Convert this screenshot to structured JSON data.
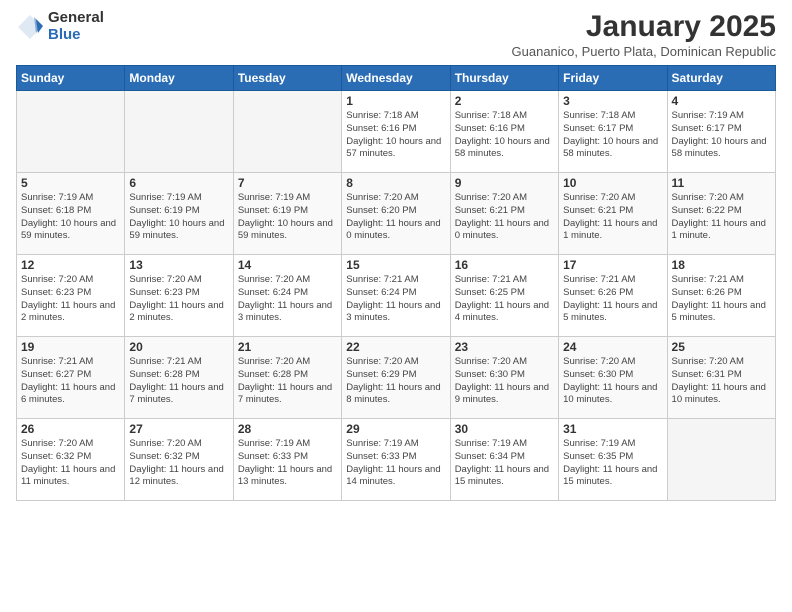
{
  "logo": {
    "general": "General",
    "blue": "Blue"
  },
  "title": "January 2025",
  "subtitle": "Guananico, Puerto Plata, Dominican Republic",
  "days_of_week": [
    "Sunday",
    "Monday",
    "Tuesday",
    "Wednesday",
    "Thursday",
    "Friday",
    "Saturday"
  ],
  "weeks": [
    [
      {
        "day": "",
        "info": ""
      },
      {
        "day": "",
        "info": ""
      },
      {
        "day": "",
        "info": ""
      },
      {
        "day": "1",
        "info": "Sunrise: 7:18 AM\nSunset: 6:16 PM\nDaylight: 10 hours and 57 minutes."
      },
      {
        "day": "2",
        "info": "Sunrise: 7:18 AM\nSunset: 6:16 PM\nDaylight: 10 hours and 58 minutes."
      },
      {
        "day": "3",
        "info": "Sunrise: 7:18 AM\nSunset: 6:17 PM\nDaylight: 10 hours and 58 minutes."
      },
      {
        "day": "4",
        "info": "Sunrise: 7:19 AM\nSunset: 6:17 PM\nDaylight: 10 hours and 58 minutes."
      }
    ],
    [
      {
        "day": "5",
        "info": "Sunrise: 7:19 AM\nSunset: 6:18 PM\nDaylight: 10 hours and 59 minutes."
      },
      {
        "day": "6",
        "info": "Sunrise: 7:19 AM\nSunset: 6:19 PM\nDaylight: 10 hours and 59 minutes."
      },
      {
        "day": "7",
        "info": "Sunrise: 7:19 AM\nSunset: 6:19 PM\nDaylight: 10 hours and 59 minutes."
      },
      {
        "day": "8",
        "info": "Sunrise: 7:20 AM\nSunset: 6:20 PM\nDaylight: 11 hours and 0 minutes."
      },
      {
        "day": "9",
        "info": "Sunrise: 7:20 AM\nSunset: 6:21 PM\nDaylight: 11 hours and 0 minutes."
      },
      {
        "day": "10",
        "info": "Sunrise: 7:20 AM\nSunset: 6:21 PM\nDaylight: 11 hours and 1 minute."
      },
      {
        "day": "11",
        "info": "Sunrise: 7:20 AM\nSunset: 6:22 PM\nDaylight: 11 hours and 1 minute."
      }
    ],
    [
      {
        "day": "12",
        "info": "Sunrise: 7:20 AM\nSunset: 6:23 PM\nDaylight: 11 hours and 2 minutes."
      },
      {
        "day": "13",
        "info": "Sunrise: 7:20 AM\nSunset: 6:23 PM\nDaylight: 11 hours and 2 minutes."
      },
      {
        "day": "14",
        "info": "Sunrise: 7:20 AM\nSunset: 6:24 PM\nDaylight: 11 hours and 3 minutes."
      },
      {
        "day": "15",
        "info": "Sunrise: 7:21 AM\nSunset: 6:24 PM\nDaylight: 11 hours and 3 minutes."
      },
      {
        "day": "16",
        "info": "Sunrise: 7:21 AM\nSunset: 6:25 PM\nDaylight: 11 hours and 4 minutes."
      },
      {
        "day": "17",
        "info": "Sunrise: 7:21 AM\nSunset: 6:26 PM\nDaylight: 11 hours and 5 minutes."
      },
      {
        "day": "18",
        "info": "Sunrise: 7:21 AM\nSunset: 6:26 PM\nDaylight: 11 hours and 5 minutes."
      }
    ],
    [
      {
        "day": "19",
        "info": "Sunrise: 7:21 AM\nSunset: 6:27 PM\nDaylight: 11 hours and 6 minutes."
      },
      {
        "day": "20",
        "info": "Sunrise: 7:21 AM\nSunset: 6:28 PM\nDaylight: 11 hours and 7 minutes."
      },
      {
        "day": "21",
        "info": "Sunrise: 7:20 AM\nSunset: 6:28 PM\nDaylight: 11 hours and 7 minutes."
      },
      {
        "day": "22",
        "info": "Sunrise: 7:20 AM\nSunset: 6:29 PM\nDaylight: 11 hours and 8 minutes."
      },
      {
        "day": "23",
        "info": "Sunrise: 7:20 AM\nSunset: 6:30 PM\nDaylight: 11 hours and 9 minutes."
      },
      {
        "day": "24",
        "info": "Sunrise: 7:20 AM\nSunset: 6:30 PM\nDaylight: 11 hours and 10 minutes."
      },
      {
        "day": "25",
        "info": "Sunrise: 7:20 AM\nSunset: 6:31 PM\nDaylight: 11 hours and 10 minutes."
      }
    ],
    [
      {
        "day": "26",
        "info": "Sunrise: 7:20 AM\nSunset: 6:32 PM\nDaylight: 11 hours and 11 minutes."
      },
      {
        "day": "27",
        "info": "Sunrise: 7:20 AM\nSunset: 6:32 PM\nDaylight: 11 hours and 12 minutes."
      },
      {
        "day": "28",
        "info": "Sunrise: 7:19 AM\nSunset: 6:33 PM\nDaylight: 11 hours and 13 minutes."
      },
      {
        "day": "29",
        "info": "Sunrise: 7:19 AM\nSunset: 6:33 PM\nDaylight: 11 hours and 14 minutes."
      },
      {
        "day": "30",
        "info": "Sunrise: 7:19 AM\nSunset: 6:34 PM\nDaylight: 11 hours and 15 minutes."
      },
      {
        "day": "31",
        "info": "Sunrise: 7:19 AM\nSunset: 6:35 PM\nDaylight: 11 hours and 15 minutes."
      },
      {
        "day": "",
        "info": ""
      }
    ]
  ]
}
